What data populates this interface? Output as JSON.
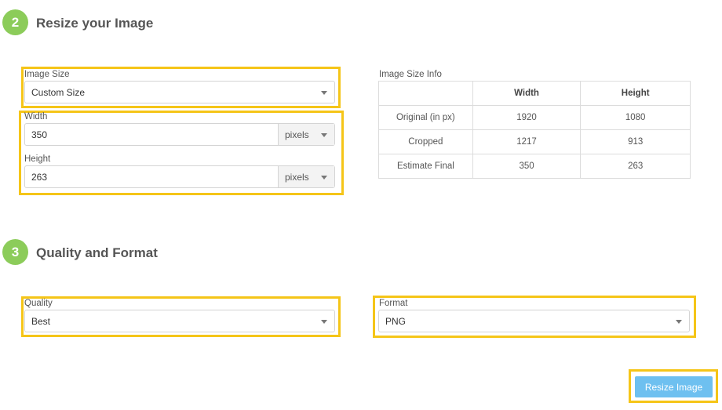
{
  "section2": {
    "step": "2",
    "title": "Resize your Image"
  },
  "image_size": {
    "label": "Image Size",
    "selected": "Custom Size"
  },
  "width": {
    "label": "Width",
    "value": "350",
    "unit": "pixels"
  },
  "height": {
    "label": "Height",
    "value": "263",
    "unit": "pixels"
  },
  "info": {
    "label": "Image Size Info",
    "headers": [
      "",
      "Width",
      "Height"
    ],
    "rows": [
      {
        "name": "Original (in px)",
        "width": "1920",
        "height": "1080"
      },
      {
        "name": "Cropped",
        "width": "1217",
        "height": "913"
      },
      {
        "name": "Estimate Final",
        "width": "350",
        "height": "263"
      }
    ]
  },
  "section3": {
    "step": "3",
    "title": "Quality and Format"
  },
  "quality": {
    "label": "Quality",
    "selected": "Best"
  },
  "format": {
    "label": "Format",
    "selected": "PNG"
  },
  "resize_button": {
    "label": "Resize Image"
  },
  "colors": {
    "step_green": "#8ccc5a",
    "highlight": "#f5c518",
    "button_blue": "#6ec0f0"
  }
}
